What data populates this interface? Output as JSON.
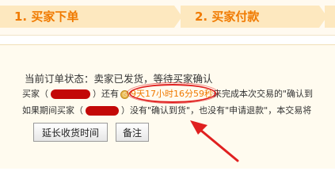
{
  "steps": {
    "step1": "1. 买家下单",
    "step2": "2. 买家付款"
  },
  "status": {
    "label": "当前订单状态：卖家已发货，等待买家确认"
  },
  "notice": {
    "line1_prefix": "买家（",
    "line1_mid": "）还有",
    "countdown": "9天17小时16分59秒",
    "line1_suffix": "来完成本次交易的\"确认到",
    "line2_prefix": "如果期间买家（",
    "line2_suffix": "）没有\"确认到货\"，也没有\"申请退款\"，本交易将"
  },
  "buttons": {
    "extend": "延长收货时间",
    "note": "备注"
  },
  "colors": {
    "accent": "#f07a00",
    "annotation": "#e02020",
    "redaction": "#c30808"
  }
}
